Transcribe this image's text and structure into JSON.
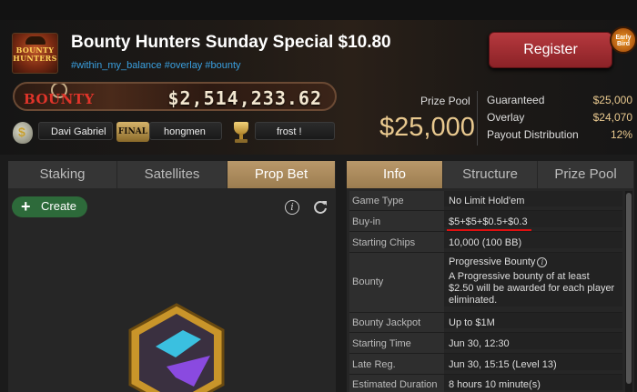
{
  "tournament": {
    "title": "Bounty Hunters Sunday Special $10.80",
    "tags": "#within_my_balance #overlay #bounty",
    "logo_text": "BOUNTY HUNTERS",
    "register_label": "Register",
    "early_badge": "Early Bird"
  },
  "bounty_banner": {
    "label": "BOUNTY",
    "amount": "$2,514,233.62"
  },
  "leaders": [
    {
      "icon": "money-bag-icon",
      "name": "Davi Gabriel"
    },
    {
      "icon": "final-table-icon",
      "badge": "FINAL",
      "name": "hongmen"
    },
    {
      "icon": "trophy-icon",
      "name": "frost !"
    }
  ],
  "prize_pool": {
    "label": "Prize Pool",
    "amount": "$25,000",
    "guaranteed_label": "Guaranteed",
    "guaranteed_value": "$25,000",
    "overlay_label": "Overlay",
    "overlay_value": "$24,070",
    "payout_label": "Payout Distribution",
    "payout_value": "12%"
  },
  "left_tabs": [
    "Staking",
    "Satellites",
    "Prop Bet"
  ],
  "left_active_tab": "Prop Bet",
  "create_label": "Create",
  "right_tabs": [
    "Info",
    "Structure",
    "Prize Pool"
  ],
  "right_active_tab": "Info",
  "info_rows": [
    {
      "key": "Game Type",
      "value": "No Limit Hold'em"
    },
    {
      "key": "Buy-in",
      "value": "$5+$5+$0.5+$0.3"
    },
    {
      "key": "Starting Chips",
      "value": "10,000 (100 BB)"
    },
    {
      "key": "Bounty",
      "title": "Progressive Bounty",
      "value": "A Progressive bounty of at least $2.50 will be awarded for each player eliminated."
    },
    {
      "key": "Bounty Jackpot",
      "value": "Up to $1M"
    },
    {
      "key": "Starting Time",
      "value": "Jun 30, 12:30"
    },
    {
      "key": "Late Reg.",
      "value": "Jun 30, 15:15 (Level 13)"
    },
    {
      "key": "Estimated Duration",
      "value": "8 hours 10 minute(s)"
    }
  ],
  "colors": {
    "accent_gold": "#e9c98f",
    "register_red": "#9c2a2f",
    "tab_active": "#ab8c5e",
    "create_green": "#2d6a3a",
    "tag_blue": "#3aa0e0"
  }
}
